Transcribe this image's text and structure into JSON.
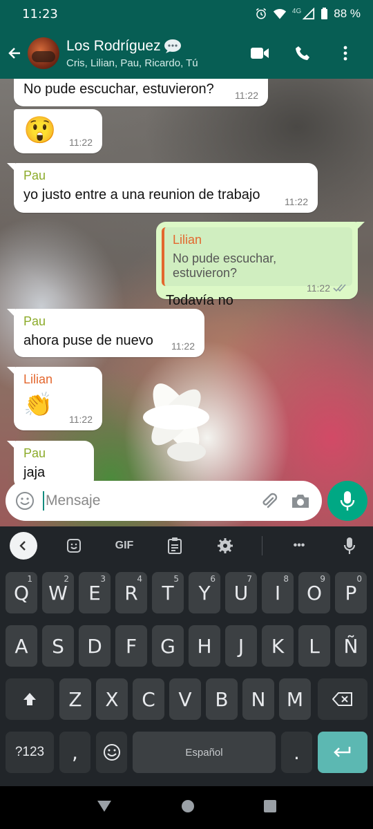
{
  "status": {
    "time": "11:23",
    "network": "4G",
    "battery": "88 %"
  },
  "header": {
    "title": "Los Rodríguez",
    "subtitle": "Cris, Lilian, Pau, Ricardo, Tú"
  },
  "messages": [
    {
      "dir": "in",
      "text": "No pude escuchar, estuvieron?",
      "time": "11:22"
    },
    {
      "dir": "in",
      "emoji": "😲",
      "time": "11:22"
    },
    {
      "dir": "in",
      "sender": "Pau",
      "text": "yo justo entre a una reunion de trabajo",
      "time": "11:22"
    },
    {
      "dir": "out",
      "quote_sender": "Lilian",
      "quote_text": "No pude escuchar, estuvieron?",
      "text": "Todavía no",
      "time": "11:22"
    },
    {
      "dir": "in",
      "sender": "Pau",
      "text": "ahora puse de nuevo",
      "time": "11:22"
    },
    {
      "dir": "in",
      "sender": "Lilian",
      "emoji": "👏",
      "time": "11:22"
    },
    {
      "dir": "in",
      "sender": "Pau",
      "text": "jaja"
    }
  ],
  "composer": {
    "placeholder": "Mensaje"
  },
  "keyboard": {
    "toolbar": {
      "gif": "GIF",
      "more": "•••"
    },
    "row1": [
      "Q",
      "W",
      "E",
      "R",
      "T",
      "Y",
      "U",
      "I",
      "O",
      "P"
    ],
    "row1_hints": [
      "1",
      "2",
      "3",
      "4",
      "5",
      "6",
      "7",
      "8",
      "9",
      "0"
    ],
    "row2": [
      "A",
      "S",
      "D",
      "F",
      "G",
      "H",
      "J",
      "K",
      "L",
      "Ñ"
    ],
    "row3": [
      "Z",
      "X",
      "C",
      "V",
      "B",
      "N",
      "M"
    ],
    "symbols": "?123",
    "comma": ",",
    "space": "Español",
    "period": "."
  },
  "colors": {
    "header": "#075e54",
    "accent": "#00a884",
    "outgoing": "#dcf8c6",
    "pau": "#8cab2a",
    "lilian": "#e3672e"
  }
}
